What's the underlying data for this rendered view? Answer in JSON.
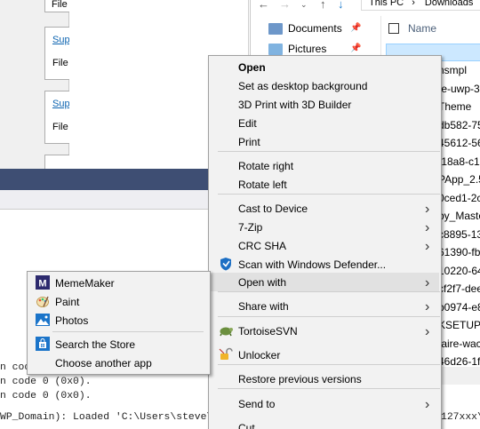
{
  "left_dialog": {
    "top_file_label": "File",
    "panels": [
      {
        "title": "Sup",
        "file": "File"
      },
      {
        "title": "Sup",
        "file": "File"
      }
    ]
  },
  "explorer": {
    "address": {
      "crumbs": [
        "This PC",
        "Downloads"
      ],
      "separator": "›"
    },
    "nav_items": [
      {
        "label": "Documents",
        "icon": "documents-icon"
      },
      {
        "label": "Pictures",
        "icon": "pictures-icon"
      }
    ],
    "column_name": "Name",
    "files": [
      "nsmpl",
      "te-uwp-3",
      "Theme",
      "db582-75",
      "45612-56",
      "f18a8-c18",
      "PApp_2.5",
      "0ced1-2c",
      "by_Maste",
      "c8895-13",
      "61390-fb",
      "10220-64",
      "cf2f7-dee",
      "b0974-e8",
      "KSETUP",
      "taire-wac",
      "46d26-1f5"
    ]
  },
  "output": {
    "lines": [
      "n code 0 (0x0).",
      "n code 0 (0x0).",
      "n code 0 (0x0).",
      "WP_Domain): Loaded 'C:\\Users\\steve\\A",
      "127xxx\\"
    ]
  },
  "main_menu": {
    "items": [
      {
        "label": "Open",
        "bold": true,
        "icon": "",
        "submenu": false
      },
      {
        "label": "Set as desktop background",
        "icon": "",
        "submenu": false
      },
      {
        "label": "3D Print with 3D Builder",
        "icon": "",
        "submenu": false
      },
      {
        "label": "Edit",
        "icon": "",
        "submenu": false
      },
      {
        "label": "Print",
        "icon": "",
        "submenu": false
      },
      {
        "label": "Rotate right",
        "icon": "",
        "submenu": false
      },
      {
        "label": "Rotate left",
        "icon": "",
        "submenu": false
      },
      {
        "label": "Cast to Device",
        "icon": "",
        "submenu": true
      },
      {
        "label": "7-Zip",
        "icon": "",
        "submenu": true
      },
      {
        "label": "CRC SHA",
        "icon": "",
        "submenu": true
      },
      {
        "label": "Scan with Windows Defender...",
        "icon": "windows-defender-icon",
        "submenu": false
      },
      {
        "label": "Open with",
        "icon": "",
        "submenu": true,
        "active": true
      },
      {
        "label": "Share with",
        "icon": "",
        "submenu": true
      },
      {
        "label": "TortoiseSVN",
        "icon": "tortoisesvn-icon",
        "submenu": true
      },
      {
        "label": "Unlocker",
        "icon": "unlocker-icon",
        "submenu": false
      },
      {
        "label": "Restore previous versions",
        "icon": "",
        "submenu": false
      },
      {
        "label": "Send to",
        "icon": "",
        "submenu": true
      },
      {
        "label": "Cut",
        "icon": "",
        "submenu": false
      }
    ]
  },
  "open_with_menu": {
    "items": [
      {
        "label": "MemeMaker",
        "icon": "mememaker-icon"
      },
      {
        "label": "Paint",
        "icon": "paint-icon"
      },
      {
        "label": "Photos",
        "icon": "photos-icon"
      },
      {
        "label": "Search the Store",
        "icon": "store-icon"
      },
      {
        "label": "Choose another app",
        "icon": ""
      }
    ]
  },
  "colors": {
    "menu_bg": "#f2f2f2",
    "menu_hover": "#e1e1e1",
    "selection": "#cce8ff",
    "vs_titlebar": "#3e4e73"
  }
}
